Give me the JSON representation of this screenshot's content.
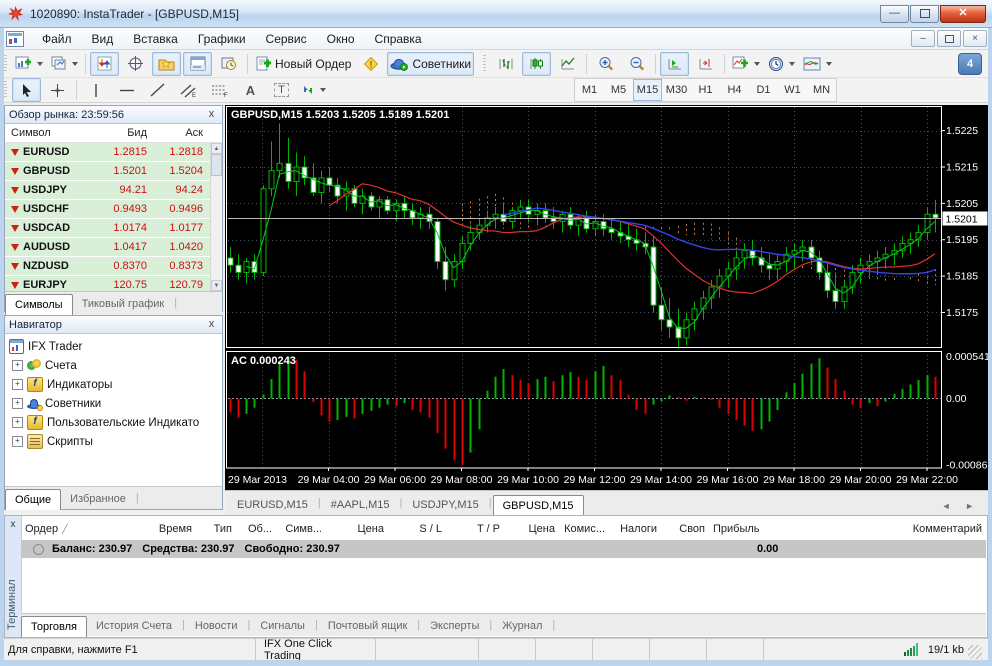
{
  "window": {
    "title": "1020890: InstaTrader - [GBPUSD,M15]"
  },
  "menu": {
    "items": [
      "Файл",
      "Вид",
      "Вставка",
      "Графики",
      "Сервис",
      "Окно",
      "Справка"
    ]
  },
  "toolbar": {
    "new_order_label": "Новый Ордер",
    "experts_label": "Советники",
    "notification_count": "4",
    "timeframes": [
      "M1",
      "M5",
      "M15",
      "M30",
      "H1",
      "H4",
      "D1",
      "W1",
      "MN"
    ],
    "active_timeframe": "M15",
    "text_tool": "A",
    "label_tool": "T"
  },
  "market_watch": {
    "title": "Обзор рынка: 23:59:56",
    "columns": [
      "Символ",
      "Бид",
      "Аск"
    ],
    "rows": [
      {
        "symbol": "EURUSD",
        "bid": "1.2815",
        "ask": "1.2818"
      },
      {
        "symbol": "GBPUSD",
        "bid": "1.5201",
        "ask": "1.5204"
      },
      {
        "symbol": "USDJPY",
        "bid": "94.21",
        "ask": "94.24"
      },
      {
        "symbol": "USDCHF",
        "bid": "0.9493",
        "ask": "0.9496"
      },
      {
        "symbol": "USDCAD",
        "bid": "1.0174",
        "ask": "1.0177"
      },
      {
        "symbol": "AUDUSD",
        "bid": "1.0417",
        "ask": "1.0420"
      },
      {
        "symbol": "NZDUSD",
        "bid": "0.8370",
        "ask": "0.8373"
      },
      {
        "symbol": "EURJPY",
        "bid": "120.75",
        "ask": "120.79"
      }
    ],
    "tabs": [
      "Символы",
      "Тиковый график"
    ]
  },
  "navigator": {
    "title": "Навигатор",
    "root": "IFX Trader",
    "items": [
      "Счета",
      "Индикаторы",
      "Советники",
      "Пользовательские Индикато",
      "Скрипты"
    ],
    "tabs": [
      "Общие",
      "Избранное"
    ]
  },
  "chart_tabs": {
    "items": [
      "EURUSD,M15",
      "#AAPL,M15",
      "USDJPY,M15",
      "GBPUSD,M15"
    ],
    "active": "GBPUSD,M15"
  },
  "terminal": {
    "side_label": "Терминал",
    "columns": [
      "Ордер",
      "Время",
      "Тип",
      "Об...",
      "Симв...",
      "Цена",
      "S / L",
      "T / P",
      "Цена",
      "Комис...",
      "Налоги",
      "Своп",
      "Прибыль",
      "Комментарий"
    ],
    "balance": {
      "balance": "Баланс: 230.97",
      "equity": "Средства: 230.97",
      "free": "Свободно: 230.97",
      "profit": "0.00"
    },
    "tabs": [
      "Торговля",
      "История Счета",
      "Новости",
      "Сигналы",
      "Почтовый ящик",
      "Эксперты",
      "Журнал"
    ],
    "active_tab": "Торговля"
  },
  "status_bar": {
    "help": "Для справки, нажмите F1",
    "trading_mode": "IFX One Click Trading",
    "traffic": "19/1 kb"
  },
  "chart_data": {
    "type": "candlestick",
    "symbol_label": "GBPUSD,M15",
    "ohlc": {
      "open": "1.5203",
      "high": "1.5205",
      "low": "1.5189",
      "close": "1.5201"
    },
    "current_price": "1.5201",
    "price_axis_ticks": [
      "1.5225",
      "1.5215",
      "1.5205",
      "1.5195",
      "1.5185",
      "1.5175"
    ],
    "price_range": [
      1.51655,
      1.52315
    ],
    "time_axis_labels": [
      "29 Mar 2013",
      "29 Mar 04:00",
      "29 Mar 06:00",
      "29 Mar 08:00",
      "29 Mar 10:00",
      "29 Mar 12:00",
      "29 Mar 14:00",
      "29 Mar 16:00",
      "29 Mar 18:00",
      "29 Mar 20:00",
      "29 Mar 22:00"
    ],
    "pip_base": 1.5,
    "pip_size": 0.0001,
    "colors": {
      "bull_fill": "#000000",
      "bear_fill": "#ffffff",
      "candle_line": "#00b400",
      "ma_fast": "#00cc22",
      "ma_mid": "#e03030",
      "ma_slow": "#3344ee",
      "cloud": "#c87838",
      "grid": "#46525e",
      "price_line": "#b8b8b8"
    },
    "candles_pips": [
      [
        190,
        193,
        186,
        188
      ],
      [
        188,
        191,
        184,
        186
      ],
      [
        186,
        190,
        183,
        189
      ],
      [
        189,
        191,
        184,
        186
      ],
      [
        186,
        210,
        185,
        209
      ],
      [
        209,
        222,
        207,
        214
      ],
      [
        214,
        227,
        212,
        216
      ],
      [
        216,
        223,
        209,
        211
      ],
      [
        211,
        219,
        207,
        215
      ],
      [
        215,
        218,
        210,
        212
      ],
      [
        212,
        216,
        207,
        208
      ],
      [
        208,
        214,
        205,
        212
      ],
      [
        212,
        215,
        208,
        210
      ],
      [
        210,
        212,
        205,
        207
      ],
      [
        207,
        211,
        203,
        209
      ],
      [
        209,
        210,
        204,
        205
      ],
      [
        205,
        209,
        202,
        207
      ],
      [
        207,
        208,
        203,
        204
      ],
      [
        204,
        207,
        201,
        206
      ],
      [
        206,
        207,
        202,
        203
      ],
      [
        203,
        206,
        200,
        205
      ],
      [
        205,
        207,
        201,
        203
      ],
      [
        203,
        205,
        199,
        201
      ],
      [
        201,
        204,
        198,
        202
      ],
      [
        202,
        204,
        198,
        200
      ],
      [
        200,
        201,
        187,
        189
      ],
      [
        189,
        193,
        181,
        184
      ],
      [
        184,
        191,
        182,
        189
      ],
      [
        189,
        196,
        187,
        194
      ],
      [
        194,
        199,
        192,
        197
      ],
      [
        197,
        201,
        195,
        199
      ],
      [
        199,
        203,
        197,
        201
      ],
      [
        201,
        204,
        198,
        202
      ],
      [
        202,
        205,
        199,
        200
      ],
      [
        200,
        204,
        198,
        203
      ],
      [
        203,
        206,
        201,
        204
      ],
      [
        204,
        206,
        200,
        202
      ],
      [
        202,
        205,
        199,
        203
      ],
      [
        203,
        205,
        200,
        201
      ],
      [
        201,
        204,
        198,
        200
      ],
      [
        200,
        203,
        197,
        202
      ],
      [
        202,
        204,
        198,
        199
      ],
      [
        199,
        202,
        196,
        201
      ],
      [
        201,
        203,
        197,
        198
      ],
      [
        198,
        202,
        196,
        200
      ],
      [
        200,
        202,
        196,
        198
      ],
      [
        198,
        201,
        195,
        197
      ],
      [
        197,
        200,
        194,
        196
      ],
      [
        196,
        199,
        193,
        195
      ],
      [
        195,
        198,
        192,
        194
      ],
      [
        194,
        197,
        191,
        193
      ],
      [
        193,
        196,
        175,
        177
      ],
      [
        177,
        182,
        170,
        173
      ],
      [
        173,
        179,
        168,
        171
      ],
      [
        171,
        176,
        165,
        168
      ],
      [
        168,
        175,
        166,
        173
      ],
      [
        173,
        178,
        170,
        176
      ],
      [
        176,
        181,
        173,
        179
      ],
      [
        179,
        184,
        176,
        182
      ],
      [
        182,
        187,
        179,
        185
      ],
      [
        185,
        189,
        182,
        187
      ],
      [
        187,
        192,
        184,
        190
      ],
      [
        190,
        194,
        187,
        192
      ],
      [
        192,
        195,
        188,
        190
      ],
      [
        190,
        193,
        186,
        188
      ],
      [
        188,
        191,
        184,
        187
      ],
      [
        187,
        191,
        184,
        189
      ],
      [
        189,
        193,
        186,
        191
      ],
      [
        191,
        194,
        187,
        192
      ],
      [
        192,
        195,
        189,
        193
      ],
      [
        193,
        195,
        188,
        190
      ],
      [
        190,
        192,
        184,
        186
      ],
      [
        186,
        189,
        179,
        181
      ],
      [
        181,
        186,
        176,
        178
      ],
      [
        178,
        184,
        176,
        182
      ],
      [
        182,
        188,
        180,
        186
      ],
      [
        186,
        190,
        183,
        188
      ],
      [
        188,
        191,
        185,
        189
      ],
      [
        189,
        192,
        186,
        190
      ],
      [
        190,
        193,
        187,
        191
      ],
      [
        191,
        194,
        188,
        192
      ],
      [
        192,
        196,
        190,
        194
      ],
      [
        194,
        197,
        191,
        195
      ],
      [
        195,
        199,
        193,
        197
      ],
      [
        197,
        204,
        195,
        202
      ],
      [
        202,
        206,
        197,
        201
      ]
    ],
    "subchart": {
      "label": "AC",
      "value": "0.000243",
      "axis_ticks": [
        "0.000541",
        "0.00",
        "-0.00086"
      ],
      "range": [
        -0.0009,
        0.0006
      ],
      "up_color": "#00b400",
      "down_color": "#e00000",
      "values": [
        -0.00018,
        -0.00025,
        -0.0002,
        -0.00012,
        5e-05,
        0.00025,
        0.00045,
        0.00054,
        0.0005,
        0.00035,
        -5e-05,
        -0.00022,
        -0.0003,
        -0.00028,
        -0.00024,
        -0.00026,
        -0.0002,
        -0.00016,
        -0.00012,
        -8e-05,
        -0.0001,
        -6e-05,
        -0.00015,
        -0.00018,
        -0.00025,
        -0.00045,
        -0.00065,
        -0.0008,
        -0.00086,
        -0.0007,
        -0.0004,
        0.0001,
        0.00028,
        0.00038,
        0.0003,
        0.00024,
        0.0002,
        0.00025,
        0.00028,
        0.00022,
        0.0003,
        0.00034,
        0.00028,
        0.00024,
        0.00035,
        0.00042,
        0.0003,
        0.00024,
        5e-05,
        -0.00015,
        -0.0002,
        -8e-05,
        -4e-05,
        4e-05,
        2e-05,
        -3e-05,
        2e-05,
        1e-05,
        -2e-05,
        -0.00012,
        -0.0002,
        -0.00028,
        -0.00035,
        -0.00042,
        -0.0004,
        -0.0003,
        -0.00015,
        8e-05,
        0.0002,
        0.00032,
        0.00045,
        0.00052,
        0.0004,
        0.00025,
        0.0001,
        -8e-05,
        -0.00012,
        -6e-05,
        -0.0001,
        -4e-05,
        6e-05,
        0.00012,
        0.00018,
        0.00024,
        0.0003,
        0.00028
      ]
    }
  }
}
